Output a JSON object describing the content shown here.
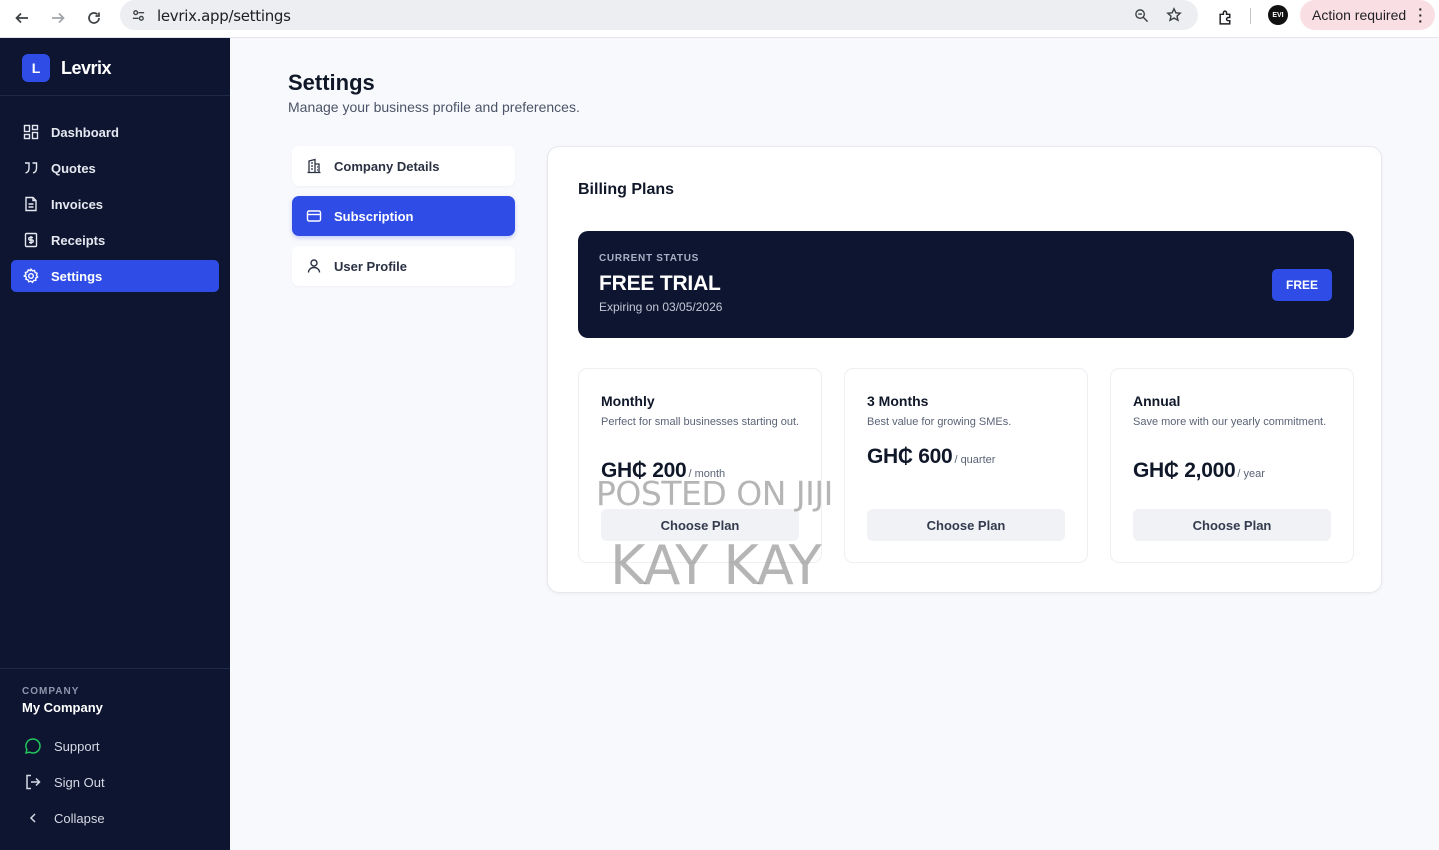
{
  "browser": {
    "url": "levrix.app/settings",
    "action_label": "Action required",
    "profile_initials": "EVI"
  },
  "brand": {
    "mark": "L",
    "name": "Levrix"
  },
  "sidebar": {
    "items": [
      {
        "label": "Dashboard",
        "icon": "dashboard-icon",
        "active": false
      },
      {
        "label": "Quotes",
        "icon": "quotes-icon",
        "active": false
      },
      {
        "label": "Invoices",
        "icon": "invoice-icon",
        "active": false
      },
      {
        "label": "Receipts",
        "icon": "receipt-icon",
        "active": false
      },
      {
        "label": "Settings",
        "icon": "gear-icon",
        "active": true
      }
    ],
    "company_label": "COMPANY",
    "company_name": "My Company",
    "support_label": "Support",
    "signout_label": "Sign Out",
    "collapse_label": "Collapse"
  },
  "page": {
    "title": "Settings",
    "subtitle": "Manage your business profile and preferences."
  },
  "tabs": [
    {
      "label": "Company Details",
      "icon": "building-icon",
      "active": false
    },
    {
      "label": "Subscription",
      "icon": "credit-card-icon",
      "active": true
    },
    {
      "label": "User Profile",
      "icon": "user-icon",
      "active": false
    }
  ],
  "billing": {
    "title": "Billing Plans",
    "status_label": "CURRENT STATUS",
    "status_value": "FREE TRIAL",
    "expiry": "Expiring on 03/05/2026",
    "badge": "FREE",
    "plans": [
      {
        "name": "Monthly",
        "description": "Perfect for small businesses starting out.",
        "price": "GH₵ 200",
        "period": "/ month",
        "button": "Choose Plan"
      },
      {
        "name": "3 Months",
        "description": "Best value for growing SMEs.",
        "price": "GH₵ 600",
        "period": "/ quarter",
        "button": "Choose Plan"
      },
      {
        "name": "Annual",
        "description": "Save more with our yearly commitment.",
        "price": "GH₵ 2,000",
        "period": "/ year",
        "button": "Choose Plan"
      }
    ]
  },
  "watermark": {
    "line1": "POSTED ON JIJI",
    "line2": "KAY KAY"
  },
  "colors": {
    "accent": "#2f4de6",
    "sidebar_bg": "#0e1530",
    "page_bg": "#f8f9fc",
    "support_icon": "#22c55e"
  }
}
